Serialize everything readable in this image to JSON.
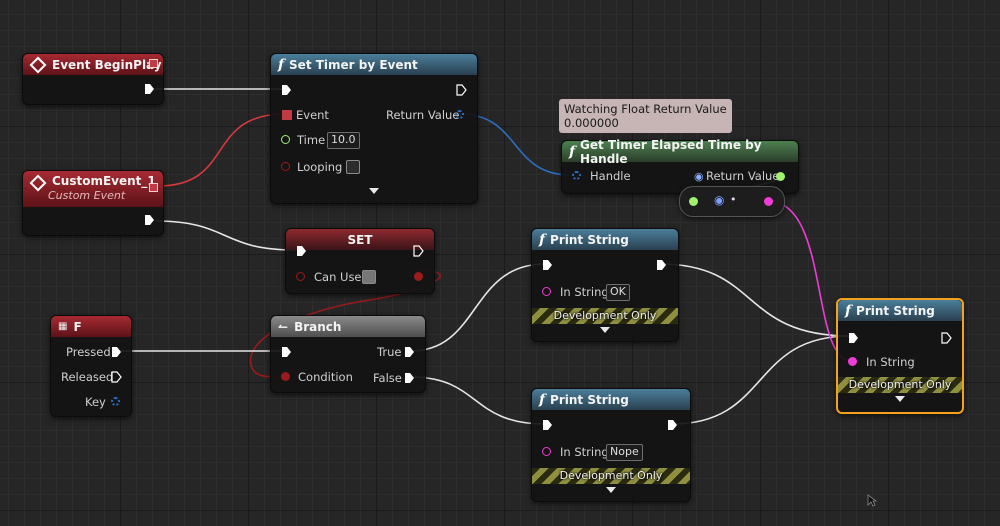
{
  "nodes": {
    "begin_play": {
      "title": "Event BeginPlay"
    },
    "custom_event": {
      "title": "CustomEvent_1",
      "subtitle": "Custom Event"
    },
    "set_timer": {
      "title": "Set Timer by Event",
      "event_label": "Event",
      "return_label": "Return Value",
      "time_label": "Time",
      "time_value": "10.0",
      "looping_label": "Looping"
    },
    "watch_tooltip": {
      "line1": "Watching Float Return Value",
      "line2": "0.000000"
    },
    "get_elapsed": {
      "title": "Get Timer Elapsed Time by Handle",
      "handle_label": "Handle",
      "return_label": "Return Value"
    },
    "set_var": {
      "title": "SET",
      "can_use_label": "Can Use"
    },
    "key_f": {
      "title": "F",
      "pressed_label": "Pressed",
      "released_label": "Released",
      "key_label": "Key"
    },
    "branch": {
      "title": "Branch",
      "condition_label": "Condition",
      "true_label": "True",
      "false_label": "False"
    },
    "print_ok": {
      "title": "Print String",
      "in_string_label": "In String",
      "in_string_value": "OK",
      "dev_label": "Development Only"
    },
    "print_nope": {
      "title": "Print String",
      "in_string_label": "In String",
      "in_string_value": "Nope",
      "dev_label": "Development Only"
    },
    "print_main": {
      "title": "Print String",
      "in_string_label": "In String",
      "dev_label": "Development Only"
    }
  },
  "colors": {
    "exec": "#ffffff",
    "delegate": "#d8393f",
    "float": "#a0f070",
    "struct_handle": "#2a6fc0",
    "bool": "#9a1b1b",
    "string": "#f03bd8",
    "selected": "#f2a21b"
  }
}
